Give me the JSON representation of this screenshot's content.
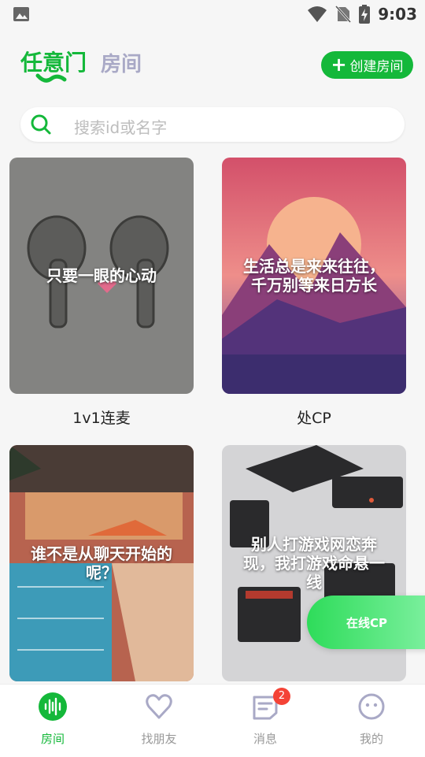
{
  "status_bar": {
    "time": "9:03"
  },
  "header": {
    "tab_main": "任意门",
    "tab_room": "房间",
    "create_button": "创建房间"
  },
  "search": {
    "placeholder": "搜索id或名字"
  },
  "rooms": [
    {
      "title": "1v1连麦",
      "caption": "只要一眼的心动"
    },
    {
      "title": "处CP",
      "caption": "生活总是来来往往，千万别等来日方长"
    },
    {
      "title": "",
      "caption": "谁不是从聊天开始的呢？"
    },
    {
      "title": "",
      "caption": "别人打游戏网恋奔现，我打游戏命悬一线"
    }
  ],
  "floating": {
    "online_cp": "在线CP"
  },
  "nav": {
    "items": [
      {
        "label": "房间",
        "icon": "voice-wave-icon"
      },
      {
        "label": "找朋友",
        "icon": "heart-icon"
      },
      {
        "label": "消息",
        "icon": "message-icon",
        "badge": "2"
      },
      {
        "label": "我的",
        "icon": "face-icon"
      }
    ]
  },
  "colors": {
    "accent": "#14b83a",
    "inactive": "#a9a9c6"
  }
}
